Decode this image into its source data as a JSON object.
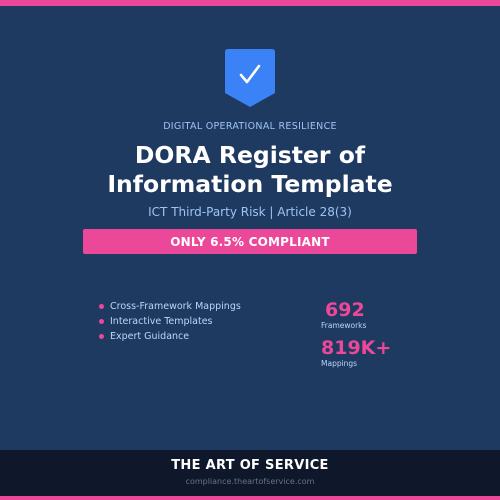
{
  "colors": {
    "background": "#1f3a60",
    "accent": "#ec4899",
    "shield": "#3b82f6",
    "footer": "#0f172a"
  },
  "header": {
    "icon": "shield-check-icon",
    "kicker": "DIGITAL OPERATIONAL RESILIENCE",
    "title_line1": "DORA Register of",
    "title_line2": "Information Template",
    "subtitle": "ICT Third-Party Risk | Article 28(3)"
  },
  "banner": {
    "text": "ONLY 6.5% COMPLIANT"
  },
  "features": [
    "Cross-Framework Mappings",
    "Interactive Templates",
    "Expert Guidance"
  ],
  "stats": [
    {
      "value": "692",
      "label": "Frameworks"
    },
    {
      "value": "819K+",
      "label": "Mappings"
    }
  ],
  "footer": {
    "brand": "THE ART OF SERVICE",
    "url": "compliance.theartofservice.com"
  }
}
